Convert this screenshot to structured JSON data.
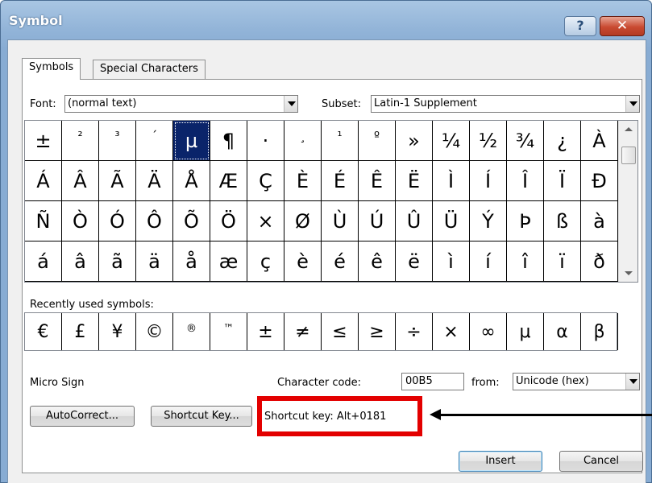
{
  "window": {
    "title": "Symbol",
    "help_label": "?",
    "close_label": "✕"
  },
  "tabs": [
    {
      "label": "Symbols",
      "active": true
    },
    {
      "label": "Special Characters",
      "active": false
    }
  ],
  "font": {
    "label": "Font:",
    "value": "(normal text)"
  },
  "subset": {
    "label": "Subset:",
    "value": "Latin-1 Supplement"
  },
  "symbol_grid": [
    [
      "±",
      "²",
      "³",
      "´",
      "µ",
      "¶",
      "·",
      "¸",
      "¹",
      "º",
      "»",
      "¼",
      "½",
      "¾",
      "¿",
      "À"
    ],
    [
      "Á",
      "Â",
      "Ã",
      "Ä",
      "Å",
      "Æ",
      "Ç",
      "È",
      "É",
      "Ê",
      "Ë",
      "Ì",
      "Í",
      "Î",
      "Ï",
      "Ð"
    ],
    [
      "Ñ",
      "Ò",
      "Ó",
      "Ô",
      "Õ",
      "Ö",
      "×",
      "Ø",
      "Ù",
      "Ú",
      "Û",
      "Ü",
      "Ý",
      "Þ",
      "ß",
      "à"
    ],
    [
      "á",
      "â",
      "ã",
      "ä",
      "å",
      "æ",
      "ç",
      "è",
      "é",
      "ê",
      "ë",
      "ì",
      "í",
      "î",
      "ï",
      "ð"
    ]
  ],
  "selected_symbol": "µ",
  "recent": {
    "label": "Recently used symbols:",
    "symbols": [
      "€",
      "£",
      "¥",
      "©",
      "®",
      "™",
      "±",
      "≠",
      "≤",
      "≥",
      "÷",
      "×",
      "∞",
      "μ",
      "α",
      "β"
    ]
  },
  "char_name": "Micro Sign",
  "char_code": {
    "label": "Character code:",
    "value": "00B5"
  },
  "from": {
    "label": "from:",
    "value": "Unicode (hex)"
  },
  "buttons": {
    "autocorrect": "AutoCorrect...",
    "shortcut_key": "Shortcut Key...",
    "insert": "Insert",
    "cancel": "Cancel"
  },
  "shortcut_text": "Shortcut key: Alt+0181",
  "colors": {
    "highlight_box": "#e30000",
    "selection": "#0a246a",
    "title_bar": "#92b4d8"
  }
}
